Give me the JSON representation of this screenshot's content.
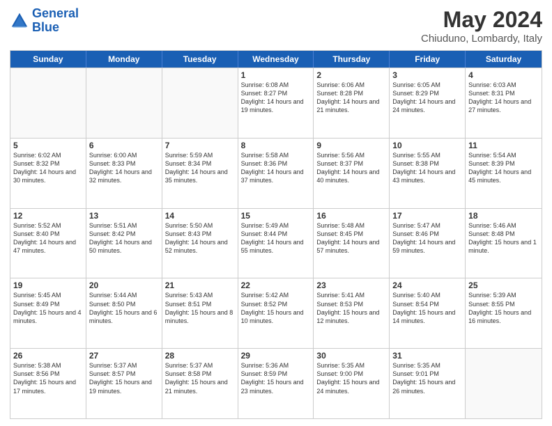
{
  "header": {
    "logo_general": "General",
    "logo_blue": "Blue",
    "month_year": "May 2024",
    "location": "Chiuduno, Lombardy, Italy"
  },
  "days": [
    "Sunday",
    "Monday",
    "Tuesday",
    "Wednesday",
    "Thursday",
    "Friday",
    "Saturday"
  ],
  "weeks": [
    [
      {
        "day": "",
        "empty": true
      },
      {
        "day": "",
        "empty": true
      },
      {
        "day": "",
        "empty": true
      },
      {
        "day": "1",
        "sunrise": "6:08 AM",
        "sunset": "8:27 PM",
        "daylight": "14 hours and 19 minutes."
      },
      {
        "day": "2",
        "sunrise": "6:06 AM",
        "sunset": "8:28 PM",
        "daylight": "14 hours and 21 minutes."
      },
      {
        "day": "3",
        "sunrise": "6:05 AM",
        "sunset": "8:29 PM",
        "daylight": "14 hours and 24 minutes."
      },
      {
        "day": "4",
        "sunrise": "6:03 AM",
        "sunset": "8:31 PM",
        "daylight": "14 hours and 27 minutes."
      }
    ],
    [
      {
        "day": "5",
        "sunrise": "6:02 AM",
        "sunset": "8:32 PM",
        "daylight": "14 hours and 30 minutes."
      },
      {
        "day": "6",
        "sunrise": "6:00 AM",
        "sunset": "8:33 PM",
        "daylight": "14 hours and 32 minutes."
      },
      {
        "day": "7",
        "sunrise": "5:59 AM",
        "sunset": "8:34 PM",
        "daylight": "14 hours and 35 minutes."
      },
      {
        "day": "8",
        "sunrise": "5:58 AM",
        "sunset": "8:36 PM",
        "daylight": "14 hours and 37 minutes."
      },
      {
        "day": "9",
        "sunrise": "5:56 AM",
        "sunset": "8:37 PM",
        "daylight": "14 hours and 40 minutes."
      },
      {
        "day": "10",
        "sunrise": "5:55 AM",
        "sunset": "8:38 PM",
        "daylight": "14 hours and 43 minutes."
      },
      {
        "day": "11",
        "sunrise": "5:54 AM",
        "sunset": "8:39 PM",
        "daylight": "14 hours and 45 minutes."
      }
    ],
    [
      {
        "day": "12",
        "sunrise": "5:52 AM",
        "sunset": "8:40 PM",
        "daylight": "14 hours and 47 minutes."
      },
      {
        "day": "13",
        "sunrise": "5:51 AM",
        "sunset": "8:42 PM",
        "daylight": "14 hours and 50 minutes."
      },
      {
        "day": "14",
        "sunrise": "5:50 AM",
        "sunset": "8:43 PM",
        "daylight": "14 hours and 52 minutes."
      },
      {
        "day": "15",
        "sunrise": "5:49 AM",
        "sunset": "8:44 PM",
        "daylight": "14 hours and 55 minutes."
      },
      {
        "day": "16",
        "sunrise": "5:48 AM",
        "sunset": "8:45 PM",
        "daylight": "14 hours and 57 minutes."
      },
      {
        "day": "17",
        "sunrise": "5:47 AM",
        "sunset": "8:46 PM",
        "daylight": "14 hours and 59 minutes."
      },
      {
        "day": "18",
        "sunrise": "5:46 AM",
        "sunset": "8:48 PM",
        "daylight": "15 hours and 1 minute."
      }
    ],
    [
      {
        "day": "19",
        "sunrise": "5:45 AM",
        "sunset": "8:49 PM",
        "daylight": "15 hours and 4 minutes."
      },
      {
        "day": "20",
        "sunrise": "5:44 AM",
        "sunset": "8:50 PM",
        "daylight": "15 hours and 6 minutes."
      },
      {
        "day": "21",
        "sunrise": "5:43 AM",
        "sunset": "8:51 PM",
        "daylight": "15 hours and 8 minutes."
      },
      {
        "day": "22",
        "sunrise": "5:42 AM",
        "sunset": "8:52 PM",
        "daylight": "15 hours and 10 minutes."
      },
      {
        "day": "23",
        "sunrise": "5:41 AM",
        "sunset": "8:53 PM",
        "daylight": "15 hours and 12 minutes."
      },
      {
        "day": "24",
        "sunrise": "5:40 AM",
        "sunset": "8:54 PM",
        "daylight": "15 hours and 14 minutes."
      },
      {
        "day": "25",
        "sunrise": "5:39 AM",
        "sunset": "8:55 PM",
        "daylight": "15 hours and 16 minutes."
      }
    ],
    [
      {
        "day": "26",
        "sunrise": "5:38 AM",
        "sunset": "8:56 PM",
        "daylight": "15 hours and 17 minutes."
      },
      {
        "day": "27",
        "sunrise": "5:37 AM",
        "sunset": "8:57 PM",
        "daylight": "15 hours and 19 minutes."
      },
      {
        "day": "28",
        "sunrise": "5:37 AM",
        "sunset": "8:58 PM",
        "daylight": "15 hours and 21 minutes."
      },
      {
        "day": "29",
        "sunrise": "5:36 AM",
        "sunset": "8:59 PM",
        "daylight": "15 hours and 23 minutes."
      },
      {
        "day": "30",
        "sunrise": "5:35 AM",
        "sunset": "9:00 PM",
        "daylight": "15 hours and 24 minutes."
      },
      {
        "day": "31",
        "sunrise": "5:35 AM",
        "sunset": "9:01 PM",
        "daylight": "15 hours and 26 minutes."
      },
      {
        "day": "",
        "empty": true
      }
    ]
  ]
}
